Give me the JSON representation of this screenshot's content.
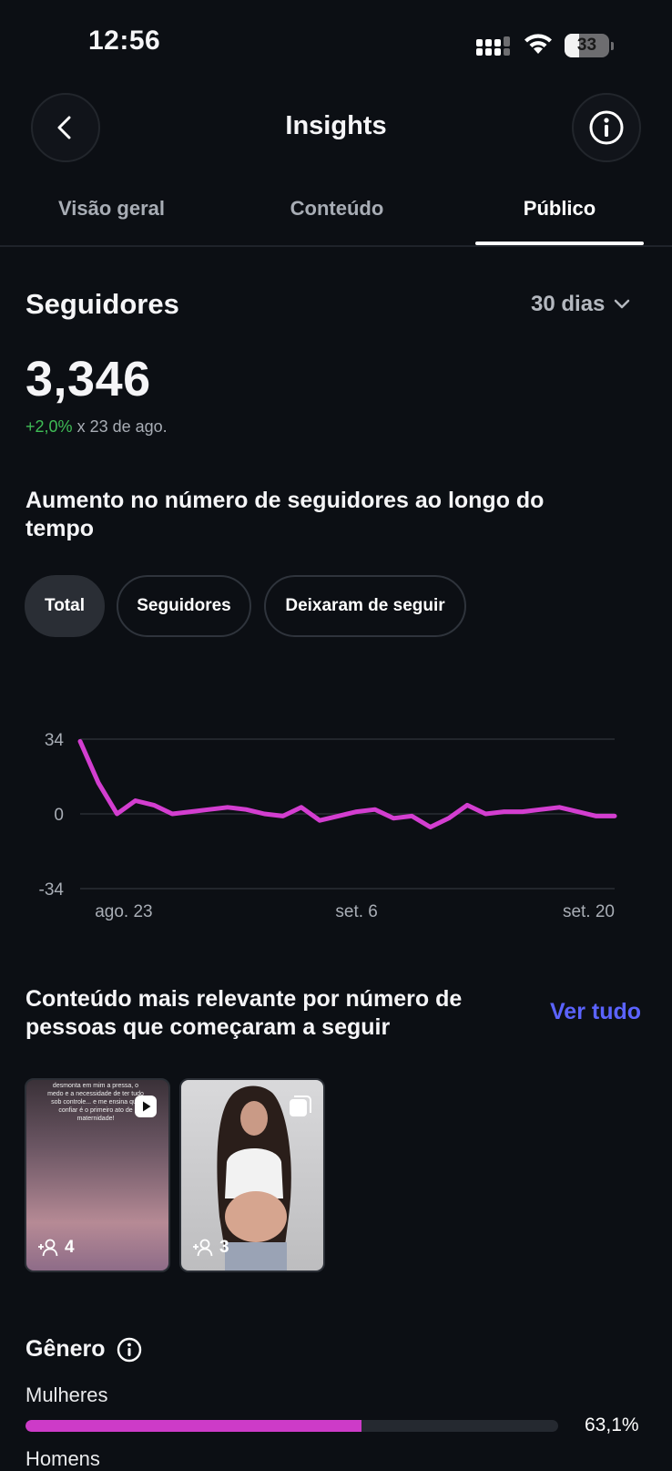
{
  "status_bar": {
    "time": "12:56",
    "battery": "33",
    "battery_level": 0.33
  },
  "header": {
    "title": "Insights"
  },
  "tabs": [
    {
      "label": "Visão geral",
      "active": false
    },
    {
      "label": "Conteúdo",
      "active": false
    },
    {
      "label": "Público",
      "active": true
    }
  ],
  "followers": {
    "heading": "Seguidores",
    "period": "30 dias",
    "count": "3,346",
    "growth_pct": "+2,0%",
    "growth_since": "x 23 de ago."
  },
  "growth_section": {
    "heading": "Aumento no número de seguidores ao longo do tempo",
    "chips": [
      "Total",
      "Seguidores",
      "Deixaram de seguir"
    ],
    "selected_chip": "Total"
  },
  "chart_data": {
    "type": "line",
    "x": [
      "ago. 22",
      "ago. 23",
      "ago. 24",
      "ago. 25",
      "ago. 26",
      "ago. 27",
      "ago. 28",
      "ago. 29",
      "ago. 30",
      "ago. 31",
      "set. 1",
      "set. 2",
      "set. 3",
      "set. 4",
      "set. 5",
      "set. 6",
      "set. 7",
      "set. 8",
      "set. 9",
      "set. 10",
      "set. 11",
      "set. 12",
      "set. 13",
      "set. 14",
      "set. 15",
      "set. 16",
      "set. 17",
      "set. 18",
      "set. 19",
      "set. 20"
    ],
    "series": [
      {
        "values": [
          33,
          14,
          0,
          6,
          4,
          0,
          1,
          2,
          3,
          2,
          0,
          -1,
          3,
          -3,
          -1,
          1,
          2,
          -2,
          -1,
          -6,
          -2,
          4,
          0,
          1,
          1,
          2,
          3,
          1,
          -1,
          -1
        ],
        "color": "#d33ed0"
      }
    ],
    "ylim": [
      -34,
      34
    ],
    "yticks": [
      "34",
      "0",
      "-34"
    ],
    "xtick_labels": [
      "ago. 23",
      "set. 6",
      "set. 20"
    ],
    "grid": true
  },
  "relevant_section": {
    "heading": "Conteúdo mais relevante por número de pessoas que começaram a seguir",
    "see_all": "Ver tudo",
    "items": [
      {
        "type": "reel",
        "count": "4",
        "caption": "desmonta em mim a pressa, o medo e a necessidade de ter tudo sob controle... e me ensina que confiar é o primeiro ato de maternidade!",
        "icon": "play-icon"
      },
      {
        "type": "carousel",
        "count": "3",
        "icon": "carousel-icon"
      }
    ]
  },
  "gender": {
    "heading": "Gênero",
    "women_label": "Mulheres",
    "women_pct": "63,1%",
    "women_value": 0.631,
    "men_label": "Homens"
  },
  "colors": {
    "accent_link": "#5b63ff",
    "growth_positive": "#3fbd56",
    "chart_line": "#d33ed0",
    "gender_bar": "#cd3bc8"
  }
}
